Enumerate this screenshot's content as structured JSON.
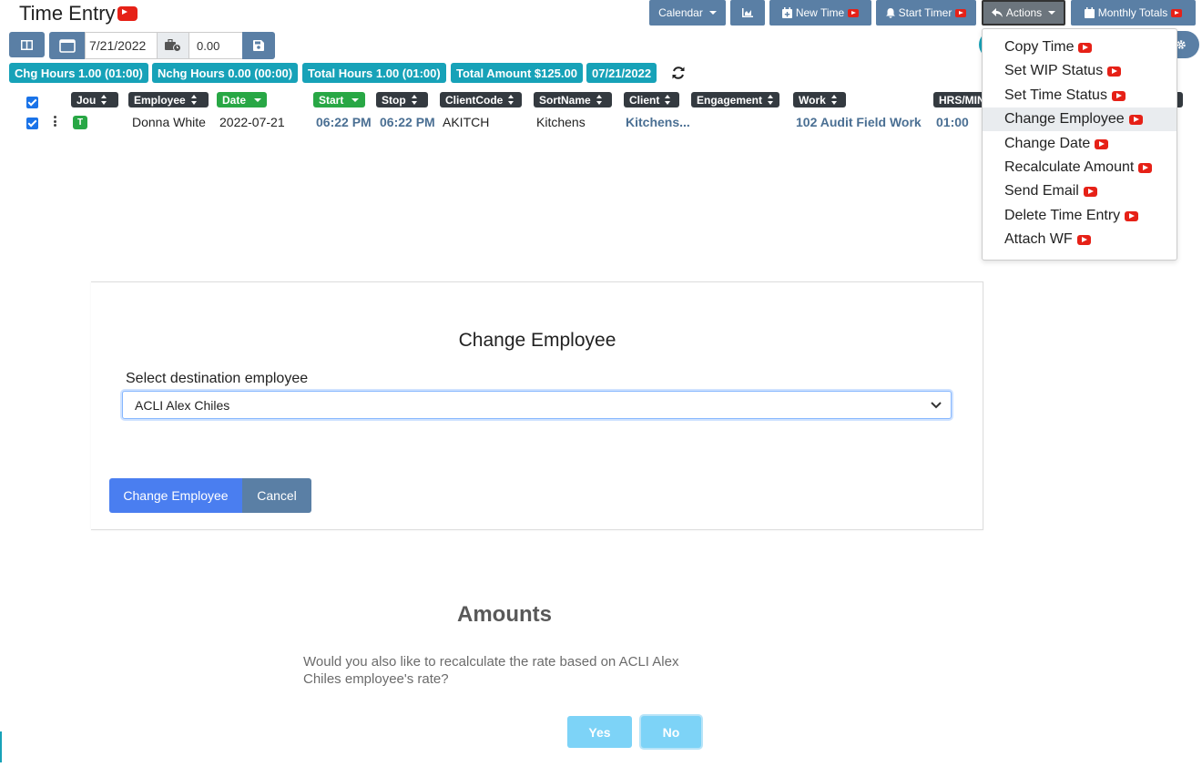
{
  "header": {
    "title": "Time Entry"
  },
  "toolbar": {
    "calendar_label": "Calendar",
    "new_time_label": "New Time",
    "start_timer_label": "Start Timer",
    "actions_label": "Actions",
    "monthly_totals_label": "Monthly Totals"
  },
  "entry_bar": {
    "date_value": "7/21/2022",
    "hours_value": "0.00"
  },
  "summary_badges": {
    "chg_hours": "Chg Hours 1.00 (01:00)",
    "nchg_hours": "Nchg Hours 0.00 (00:00)",
    "total_hours": "Total Hours 1.00 (01:00)",
    "total_amount": "Total Amount $125.00",
    "date": "07/21/2022"
  },
  "table": {
    "columns": [
      "Jou",
      "Employee",
      "Date",
      "Start",
      "Stop",
      "ClientCode",
      "SortName",
      "Client",
      "Engagement",
      "Work",
      "HRS/MIN"
    ],
    "row": {
      "journal_badge": "T",
      "employee": "Donna White",
      "date": "2022-07-21",
      "start": "06:22 PM",
      "stop": "06:22 PM",
      "client_code": "AKITCH",
      "sort_name": "Kitchens",
      "client": "Kitchens...",
      "engagement": "",
      "work": "102 Audit Field Work",
      "hrs_min": "01:00"
    }
  },
  "actions_menu": {
    "items": [
      "Copy Time",
      "Set WIP Status",
      "Set Time Status",
      "Change Employee",
      "Change Date",
      "Recalculate Amount",
      "Send Email",
      "Delete Time Entry",
      "Attach WF"
    ],
    "highlighted": "Change Employee"
  },
  "change_employee_modal": {
    "title": "Change Employee",
    "select_label": "Select destination employee",
    "selected_employee": "ACLI Alex Chiles",
    "confirm_label": "Change Employee",
    "cancel_label": "Cancel"
  },
  "amounts_modal": {
    "title": "Amounts",
    "message": "Would you also like to recalculate the rate based on ACLI Alex Chiles employee's rate?",
    "yes_label": "Yes",
    "no_label": "No"
  },
  "colors": {
    "toolbar_button": "#5a7fa5",
    "badge_teal": "#17a2b8",
    "column_header": "#343a40",
    "column_header_sorted": "#28a745",
    "primary_button": "#4a7ef0",
    "dialog_button": "#7dd3f7"
  }
}
